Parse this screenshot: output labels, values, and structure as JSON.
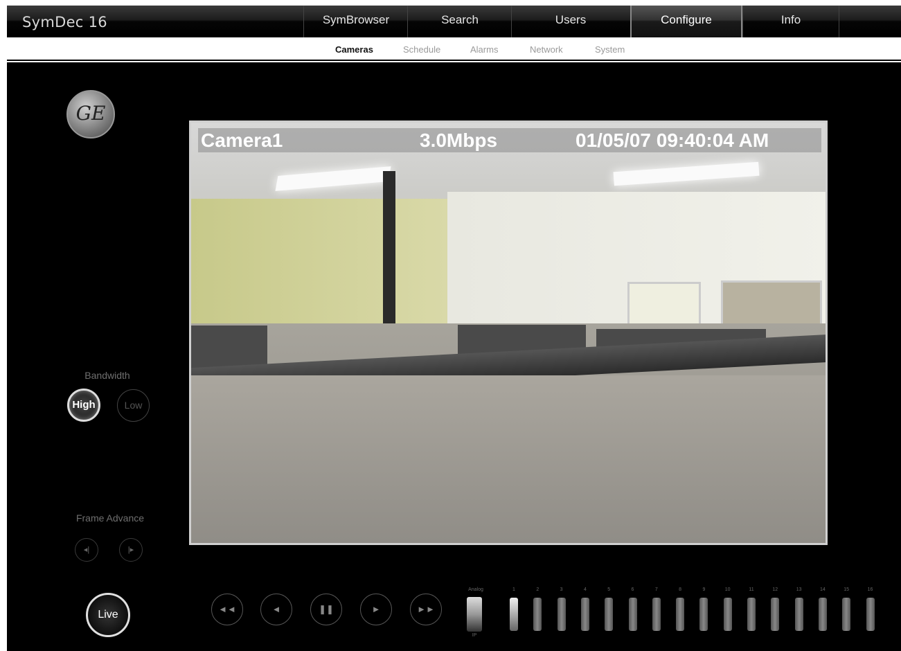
{
  "app": {
    "title": "SymDec 16"
  },
  "nav": {
    "tabs": [
      {
        "label": "SymBrowser"
      },
      {
        "label": "Search"
      },
      {
        "label": "Users"
      },
      {
        "label": "Configure"
      },
      {
        "label": "Info"
      }
    ],
    "active_tab": "Configure"
  },
  "subnav": {
    "items": [
      {
        "label": "Cameras"
      },
      {
        "label": "Schedule"
      },
      {
        "label": "Alarms"
      },
      {
        "label": "Network"
      },
      {
        "label": "System"
      }
    ],
    "active_item": "Cameras"
  },
  "left_panel": {
    "logo_text": "GE",
    "bandwidth": {
      "label": "Bandwidth",
      "high": "High",
      "low": "Low",
      "selected": "High"
    },
    "frame_advance": {
      "label": "Frame Advance",
      "back": "◂|",
      "forward": "|▸"
    },
    "live_label": "Live"
  },
  "video": {
    "camera_name": "Camera1",
    "bitrate": "3.0Mbps",
    "timestamp": "01/05/07 09:40:04 AM"
  },
  "playback": {
    "rewind": "◄◄",
    "step_back": "◄",
    "pause": "❚❚",
    "play": "►",
    "fast_forward": "►►"
  },
  "channels": {
    "analog_label": "Analog",
    "analog_sub": "IP",
    "labels": [
      "1",
      "2",
      "3",
      "4",
      "5",
      "6",
      "7",
      "8",
      "9",
      "10",
      "11",
      "12",
      "13",
      "14",
      "15",
      "16"
    ]
  },
  "colors": {
    "accent": "#ffffff",
    "background": "#000000"
  }
}
